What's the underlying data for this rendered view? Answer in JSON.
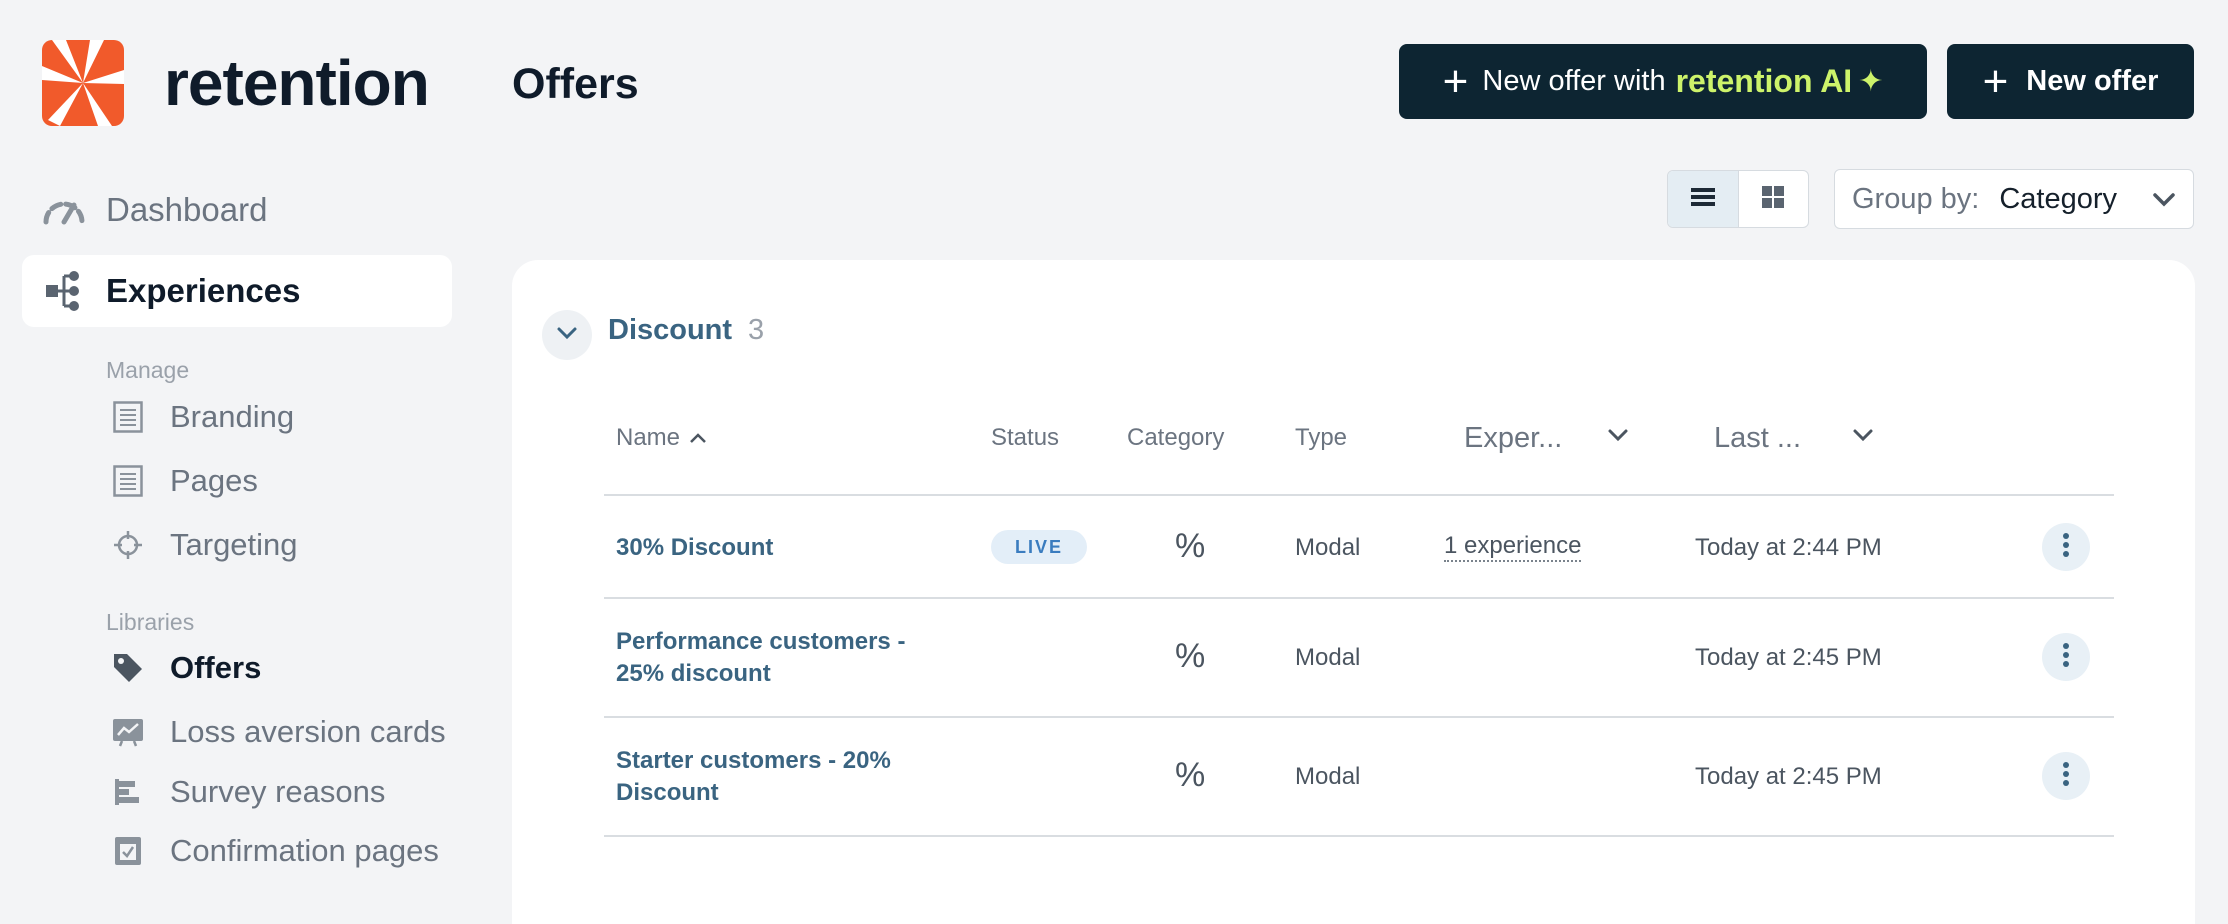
{
  "brand": {
    "name": "retention",
    "accent": "#f15a2b"
  },
  "sidebar": {
    "top_items": [
      {
        "label": "Dashboard",
        "icon": "gauge-icon"
      },
      {
        "label": "Experiences",
        "icon": "flow-tree-icon",
        "active": true
      }
    ],
    "manage_label": "Manage",
    "manage_items": [
      {
        "label": "Branding",
        "icon": "document-icon"
      },
      {
        "label": "Pages",
        "icon": "document-icon"
      },
      {
        "label": "Targeting",
        "icon": "crosshair-icon"
      }
    ],
    "libraries_label": "Libraries",
    "library_items": [
      {
        "label": "Offers",
        "icon": "tag-icon",
        "active": true
      },
      {
        "label": "Loss aversion cards",
        "icon": "chart-card-icon"
      },
      {
        "label": "Survey reasons",
        "icon": "bars-icon"
      },
      {
        "label": "Confirmation pages",
        "icon": "checkbox-icon"
      }
    ]
  },
  "header": {
    "title": "Offers",
    "ai_button": {
      "prefix": "New offer with",
      "brand": "retention AI"
    },
    "new_button": "New offer"
  },
  "toolbar": {
    "group_by_label": "Group by:",
    "group_by_value": "Category"
  },
  "group": {
    "title": "Discount",
    "count": "3"
  },
  "table": {
    "columns": {
      "name": "Name",
      "status": "Status",
      "category": "Category",
      "type": "Type",
      "experiences": "Exper...",
      "last": "Last ..."
    },
    "rows": [
      {
        "name": "30% Discount",
        "status": "LIVE",
        "category": "%",
        "type": "Modal",
        "experiences": "1 experience",
        "last": "Today at 2:44 PM"
      },
      {
        "name": "Performance customers - 25% discount",
        "status": "",
        "category": "%",
        "type": "Modal",
        "experiences": "",
        "last": "Today at 2:45 PM"
      },
      {
        "name": "Starter customers - 20% Discount",
        "status": "",
        "category": "%",
        "type": "Modal",
        "experiences": "",
        "last": "Today at 2:45 PM"
      }
    ]
  }
}
